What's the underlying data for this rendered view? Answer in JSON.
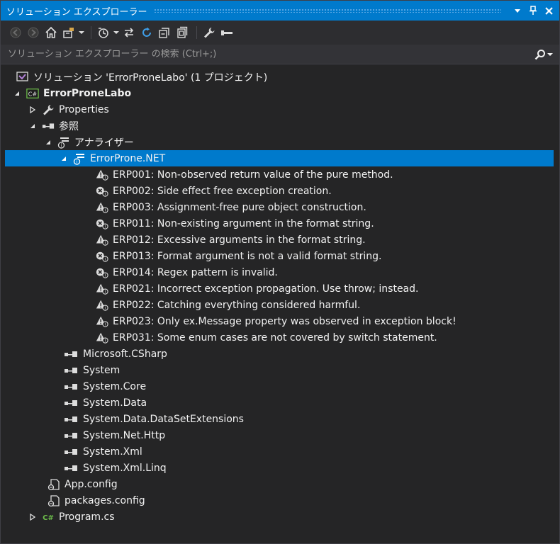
{
  "window": {
    "title": "ソリューション エクスプローラー"
  },
  "toolbar": {
    "icons": [
      "back-icon",
      "forward-icon",
      "home-icon",
      "switch-views-icon",
      "pending-changes-filter-icon",
      "sync-icon",
      "refresh-icon",
      "collapse-all-icon",
      "show-all-files-icon",
      "properties-icon",
      "preview-icon"
    ]
  },
  "search": {
    "placeholder": "ソリューション エクスプローラー の検索 (Ctrl+;)"
  },
  "colors": {
    "accent": "#007acc",
    "background": "#252526",
    "text": "#f1f1f1",
    "warning": "#cccccc"
  },
  "tree": {
    "solution": "ソリューション 'ErrorProneLabo' (1 プロジェクト)",
    "project": "ErrorProneLabo",
    "properties": "Properties",
    "references": "参照",
    "analyzers": "アナライザー",
    "analyzer": "ErrorProne.NET",
    "rules": [
      {
        "kind": "warning",
        "text": "ERP001: Non-observed return value of the pure method."
      },
      {
        "kind": "error",
        "text": "ERP002: Side effect free exception creation."
      },
      {
        "kind": "warning",
        "text": "ERP003: Assignment-free pure object construction."
      },
      {
        "kind": "error",
        "text": "ERP011: Non-existing argument in the format string."
      },
      {
        "kind": "warning",
        "text": "ERP012: Excessive arguments in the format string."
      },
      {
        "kind": "error",
        "text": "ERP013: Format argument is not a valid format string."
      },
      {
        "kind": "error",
        "text": "ERP014: Regex pattern is invalid."
      },
      {
        "kind": "warning",
        "text": "ERP021: Incorrect exception propagation. Use throw; instead."
      },
      {
        "kind": "warning",
        "text": "ERP022: Catching everything considered harmful."
      },
      {
        "kind": "warning",
        "text": "ERP023: Only ex.Message property was observed in exception block!"
      },
      {
        "kind": "warning",
        "text": "ERP031: Some enum cases are not covered by switch statement."
      }
    ],
    "assemblies": [
      "Microsoft.CSharp",
      "System",
      "System.Core",
      "System.Data",
      "System.Data.DataSetExtensions",
      "System.Net.Http",
      "System.Xml",
      "System.Xml.Linq"
    ],
    "files": {
      "app_config": "App.config",
      "packages_config": "packages.config",
      "program": "Program.cs"
    }
  }
}
